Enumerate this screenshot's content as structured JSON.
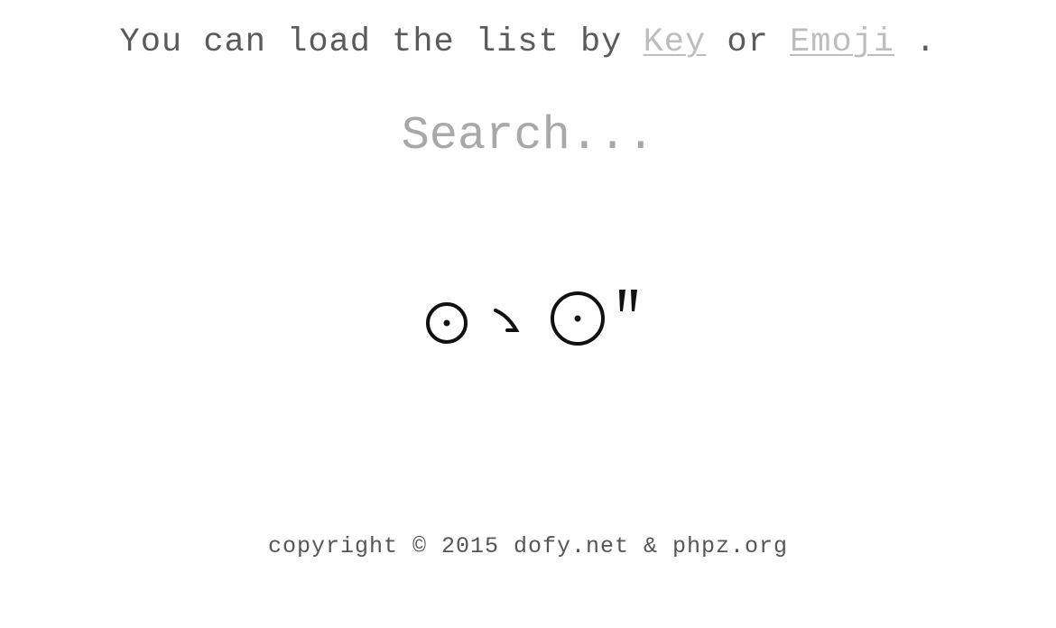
{
  "intro": {
    "prefix": "You can load the list by ",
    "key_link": "Key",
    "middle": " or ",
    "emoji_link": "Emoji",
    "suffix": " ."
  },
  "search": {
    "placeholder": "Search..."
  },
  "kaomoji": {
    "text": "⊙↘⊙\""
  },
  "footer": {
    "copyright": "copyright © 2015 dofy.net & phpz.org"
  },
  "colors": {
    "text": "#5a5a5a",
    "link": "#bdbdbd",
    "placeholder": "#a8a8a8",
    "kaomoji": "#111111"
  }
}
